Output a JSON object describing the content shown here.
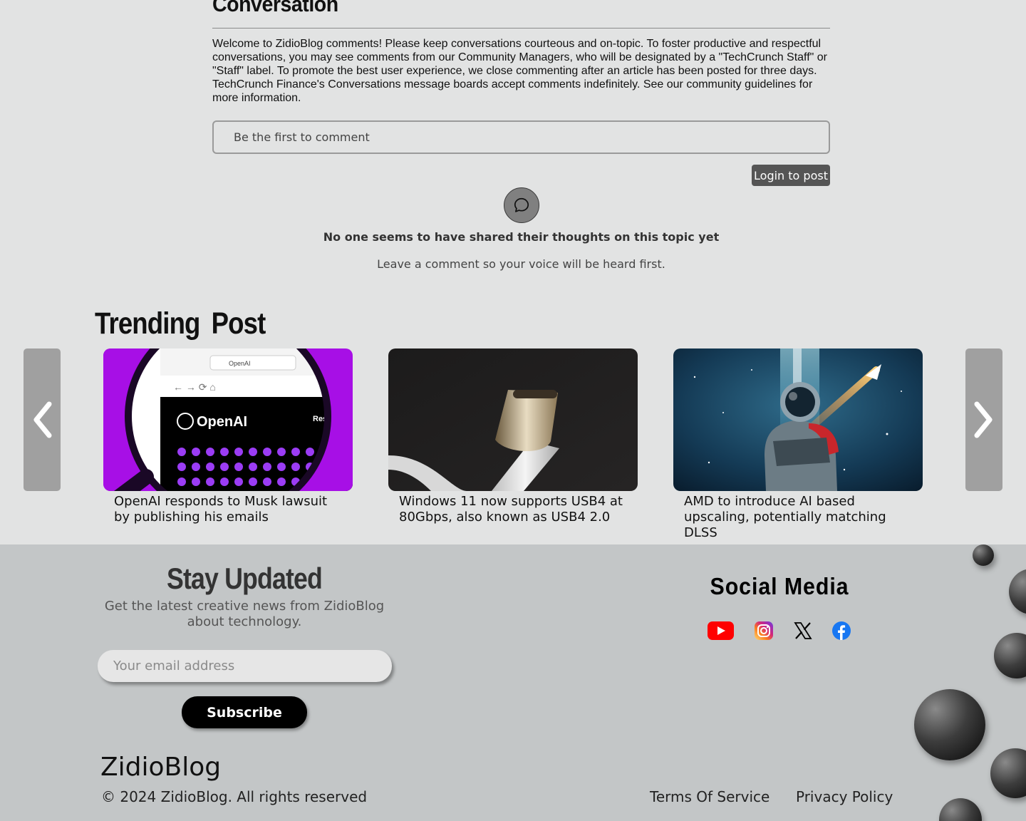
{
  "conversation": {
    "title": "Conversation",
    "intro": "Welcome to ZidioBlog comments! Please keep conversations courteous and on-topic. To foster productive and respectful conversations, you may see comments from our Community Managers, who will be designated by a \"TechCrunch Staff\" or \"Staff\" label. To promote the best user experience, we close commenting after an article has been posted for three days. TechCrunch Finance's Conversations message boards accept comments indefinitely. See our community guidelines for more information.",
    "comment_placeholder": "Be the first to comment",
    "login_label": "Login to post",
    "empty_title": "No one seems to have shared their thoughts on this topic yet",
    "empty_sub": "Leave a comment so your voice will be heard first."
  },
  "trending": {
    "title": "Trending  Post",
    "prev_icon": "chevron-left-icon",
    "next_icon": "chevron-right-icon",
    "posts": [
      {
        "title": "OpenAI responds to Musk lawsuit by publishing his emails",
        "image": "openai-magnifier-image",
        "image_text": "OpenAI",
        "image_menu": "Research"
      },
      {
        "title": "Windows 11 now supports USB4 at 80Gbps, also known as USB4 2.0",
        "image": "usb-c-cable-image"
      },
      {
        "title": "AMD to introduce AI based upscaling, potentially matching DLSS",
        "image": "astronaut-space-image"
      }
    ]
  },
  "footer": {
    "stay_title": "Stay Updated",
    "stay_sub": "Get the latest creative news from ZidioBlog about technology.",
    "email_placeholder": "Your email address",
    "subscribe_label": "Subscribe",
    "social_title": "Social Media",
    "social_icons": [
      "youtube-icon",
      "instagram-icon",
      "x-icon",
      "facebook-icon"
    ],
    "brand": "ZidioBlog",
    "copyright": "© 2024 ZidioBlog. All rights reserved",
    "terms": "Terms Of Service",
    "privacy": "Privacy Policy"
  },
  "colors": {
    "page_bg": "#e2e3e3",
    "footer_bg": "#c3c6c7",
    "login_button": "#555555",
    "subscribe_button": "#000000",
    "youtube": "#ff0000",
    "facebook": "#1877f2"
  }
}
